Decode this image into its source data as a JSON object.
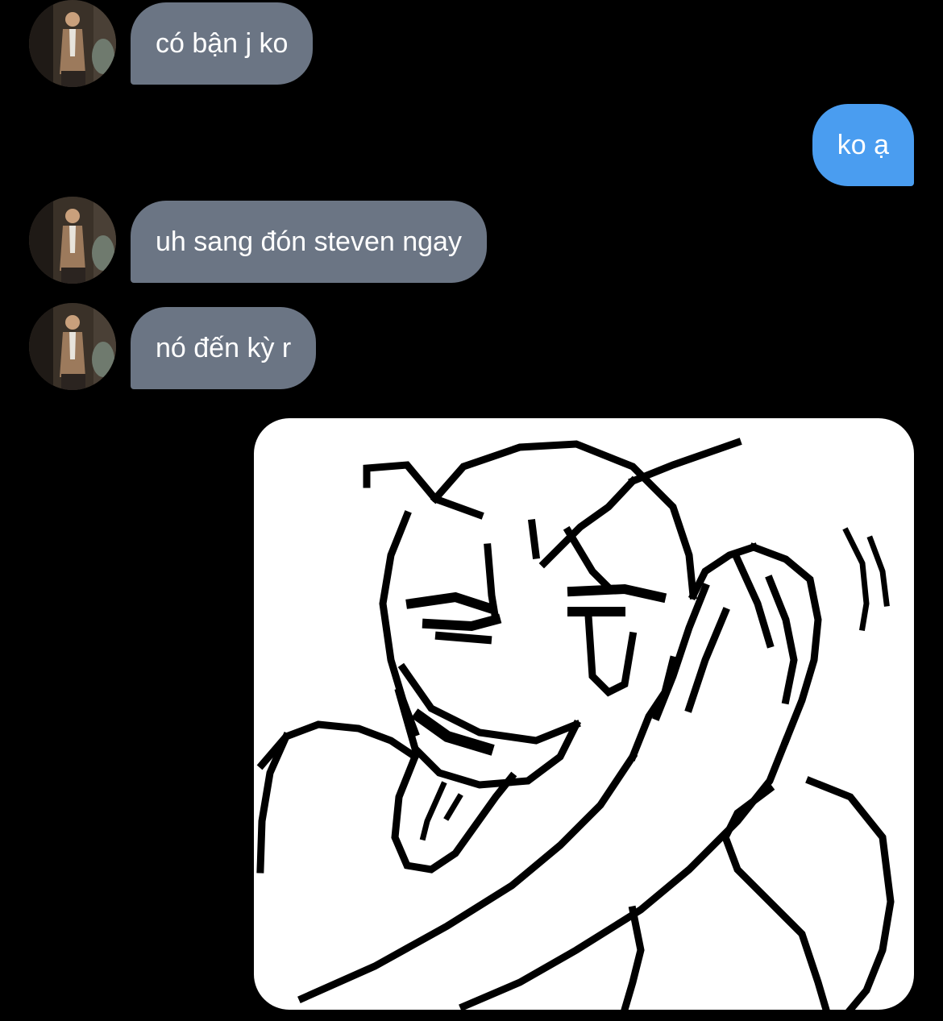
{
  "colors": {
    "background": "#000000",
    "incoming_bubble": "#6b7584",
    "outgoing_bubble": "#4a9df0",
    "bubble_text": "#ffffff"
  },
  "messages": [
    {
      "direction": "incoming",
      "text": "có bận j ko",
      "avatar": "contact-avatar-photo"
    },
    {
      "direction": "outgoing",
      "text": "ko ạ"
    },
    {
      "direction": "incoming",
      "text": "uh sang đón steven ngay",
      "avatar": "contact-avatar-photo"
    },
    {
      "direction": "incoming",
      "text": "nó đến kỳ r",
      "avatar": "contact-avatar-photo"
    },
    {
      "direction": "outgoing",
      "type": "image",
      "image": "pixel-art-laughing-meme-sticker"
    }
  ]
}
